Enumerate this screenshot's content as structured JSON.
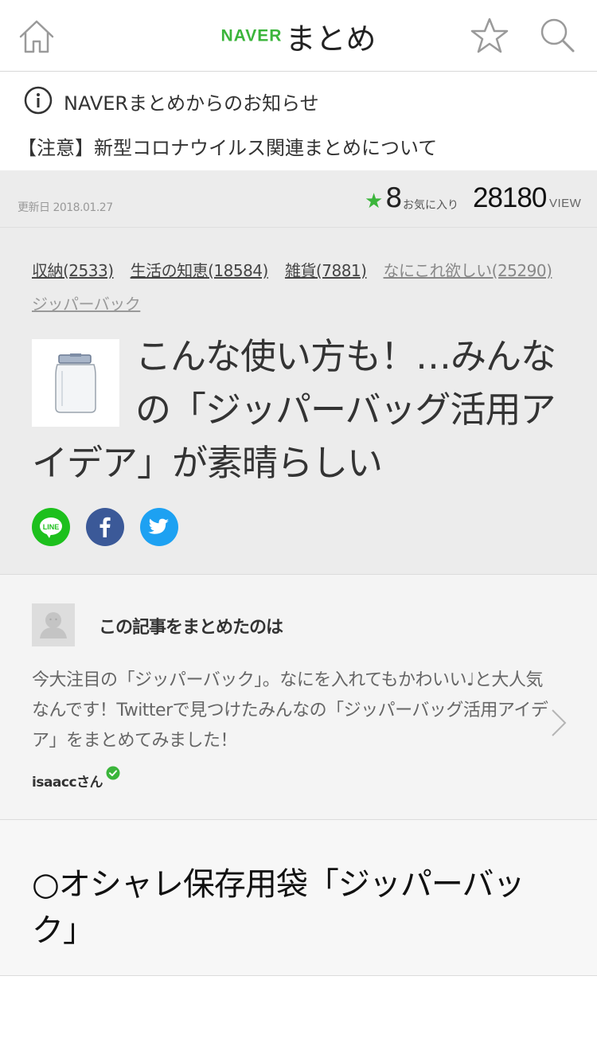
{
  "header": {
    "logo_brand": "NAVER",
    "logo_product": "まとめ",
    "home_icon": "home-icon",
    "favorite_icon": "star-outline-icon",
    "search_icon": "search-icon"
  },
  "notice": {
    "title": "NAVERまとめからのお知らせ",
    "link": "【注意】新型コロナウイルス関連まとめについて",
    "icon": "info-icon"
  },
  "stats": {
    "updated": "更新日 2018.01.27",
    "fav_count": "8",
    "fav_label": "お気に入り",
    "view_count": "28180",
    "view_label": "VIEW",
    "accent_color": "#3bb53b"
  },
  "article": {
    "tags": [
      {
        "label": "収納(2533)"
      },
      {
        "label": "生活の知恵(18584)"
      },
      {
        "label": "雑貨(7881)"
      },
      {
        "label": "なにこれ欲しい(25290)"
      },
      {
        "label": "ジッパーバック"
      }
    ],
    "title": "こんな使い方も！…みんなの「ジッパーバッグ活用アイデア」が素晴らしい",
    "share": [
      {
        "name": "LINE",
        "color": "#1dc01d"
      },
      {
        "name": "facebook",
        "color": "#3b5998"
      },
      {
        "name": "twitter",
        "color": "#1da1f2"
      }
    ]
  },
  "author": {
    "heading": "この記事をまとめたのは",
    "description": "今大注目の「ジッパーバック」。なにを入れてもかわいい♩と大人気なんです！Twitterで見つけたみんなの「ジッパーバッグ活用アイデア」をまとめてみました！",
    "name": "isaaccさん"
  },
  "section": {
    "title": "○オシャレ保存用袋「ジッパーバック」"
  }
}
